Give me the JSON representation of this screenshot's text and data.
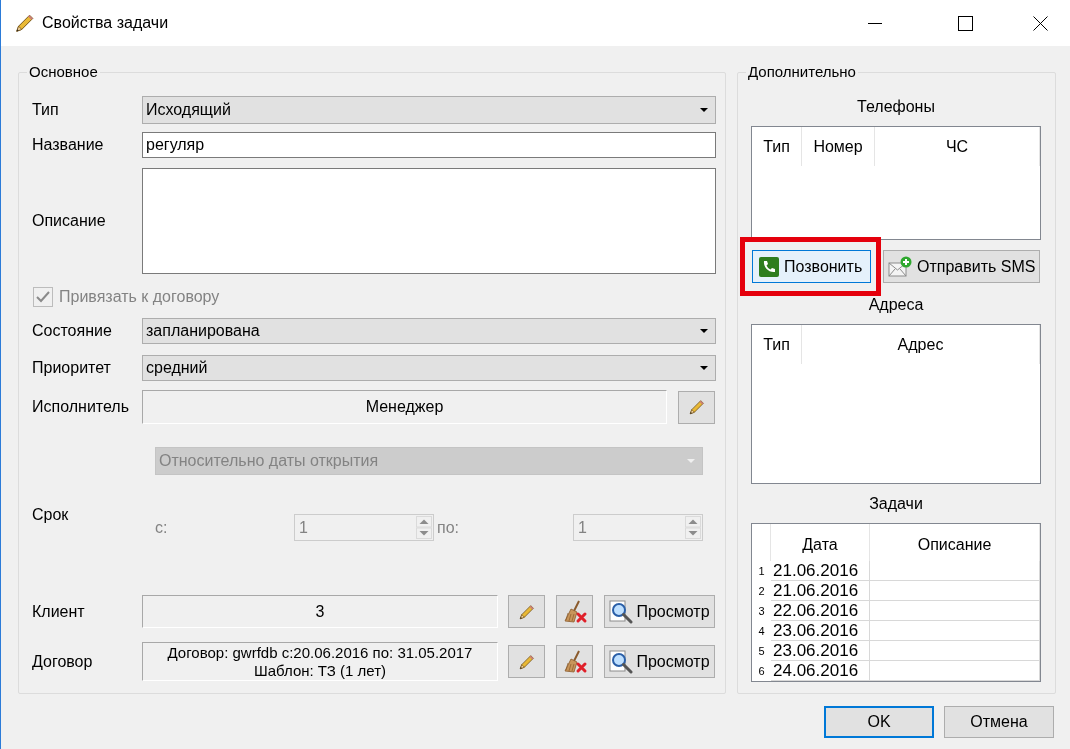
{
  "window": {
    "title": "Свойства задачи"
  },
  "main": {
    "title": "Основное",
    "type": {
      "label": "Тип",
      "value": "Исходящий"
    },
    "name": {
      "label": "Название",
      "value": "регуляр"
    },
    "description": {
      "label": "Описание"
    },
    "bind_contract": {
      "label": "Привязать к договору",
      "checked": true,
      "disabled": true
    },
    "state": {
      "label": "Состояние",
      "value": "запланирована"
    },
    "priority": {
      "label": "Приоритет",
      "value": "средний"
    },
    "executor": {
      "label": "Исполнитель",
      "value": "Менеджер"
    },
    "term": {
      "label": "Срок",
      "mode": "Относительно даты открытия",
      "disabled": true,
      "from_label": "с:",
      "from": "1",
      "to_label": "по:",
      "to": "1"
    },
    "client": {
      "label": "Клиент",
      "value": "3",
      "view_button": "Просмотр"
    },
    "contract": {
      "label": "Договор",
      "lines": [
        "Договор: gwrfdb с:20.06.2016 по: 31.05.2017",
        "Шаблон: ТЗ (1 лет)"
      ],
      "view_button": "Просмотр"
    }
  },
  "extra": {
    "title": "Дополнительно",
    "phones": {
      "title": "Телефоны",
      "columns": [
        "Тип",
        "Номер",
        "ЧС"
      ],
      "buttons": [
        {
          "kind": "call",
          "label": "Позвонить",
          "hovered": true,
          "highlighted": true
        },
        {
          "kind": "sms",
          "label": "Отправить SMS",
          "hovered": false,
          "highlighted": false
        }
      ]
    },
    "addresses": {
      "title": "Адреса",
      "columns": [
        "Тип",
        "Адрес"
      ]
    },
    "tasks": {
      "title": "Задачи",
      "columns": [
        "Дата",
        "Описание"
      ],
      "rows": [
        {
          "number": "1",
          "date": "21.06.2016"
        },
        {
          "number": "2",
          "date": "21.06.2016"
        },
        {
          "number": "3",
          "date": "22.06.2016"
        },
        {
          "number": "4",
          "date": "23.06.2016"
        },
        {
          "number": "5",
          "date": "23.06.2016"
        },
        {
          "number": "6",
          "date": "24.06.2016"
        }
      ]
    }
  },
  "buttons": [
    {
      "label": "OK",
      "default": true
    },
    {
      "label": "Отмена",
      "default": false
    }
  ]
}
